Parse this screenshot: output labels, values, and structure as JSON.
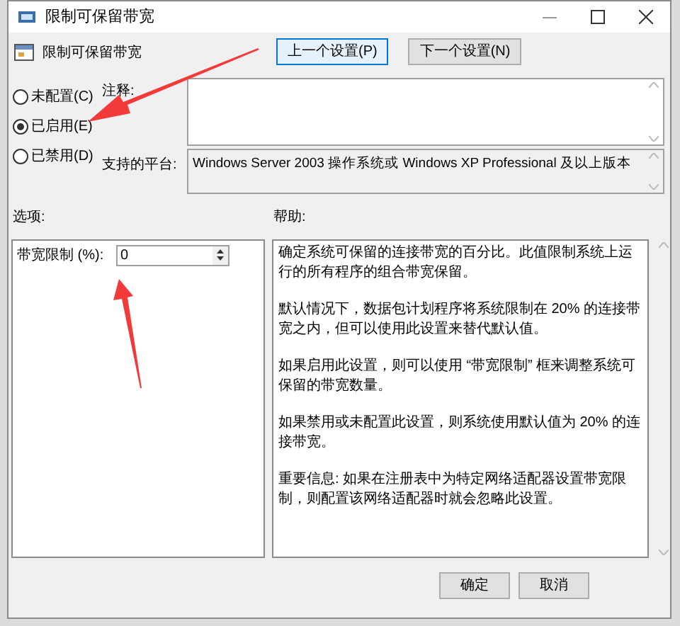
{
  "window": {
    "title": "限制可保留带宽"
  },
  "header": {
    "policy_name": "限制可保留带宽",
    "buttons": [
      {
        "label": "上一个设置(P)",
        "selected": true
      },
      {
        "label": "下一个设置(N)",
        "selected": false
      }
    ]
  },
  "state_options": [
    {
      "label": "未配置(C)",
      "selected": false
    },
    {
      "label": "已启用(E)",
      "selected": true
    },
    {
      "label": "已禁用(D)",
      "selected": false
    }
  ],
  "comment": {
    "label": "注释:"
  },
  "supported": {
    "label": "支持的平台:",
    "value": "Windows Server 2003 操作系统或 Windows XP Professional 及以上版本"
  },
  "options": {
    "label": "选项:",
    "fields": [
      {
        "label": "带宽限制 (%):",
        "value": "0"
      }
    ]
  },
  "help": {
    "label": "帮助:",
    "paragraphs": [
      "确定系统可保留的连接带宽的百分比。此值限制系统上运行的所有程序的组合带宽保留。",
      "默认情况下，数据包计划程序将系统限制在 20% 的连接带宽之内，但可以使用此设置来替代默认值。",
      "如果启用此设置，则可以使用 “带宽限制” 框来调整系统可保留的带宽数量。",
      "如果禁用或未配置此设置，则系统使用默认值为 20% 的连接带宽。",
      "重要信息: 如果在注册表中为特定网络适配器设置带宽限制，则配置该网络适配器时就会忽略此设置。"
    ]
  },
  "footer": {
    "buttons": [
      "确定",
      "取消"
    ]
  }
}
